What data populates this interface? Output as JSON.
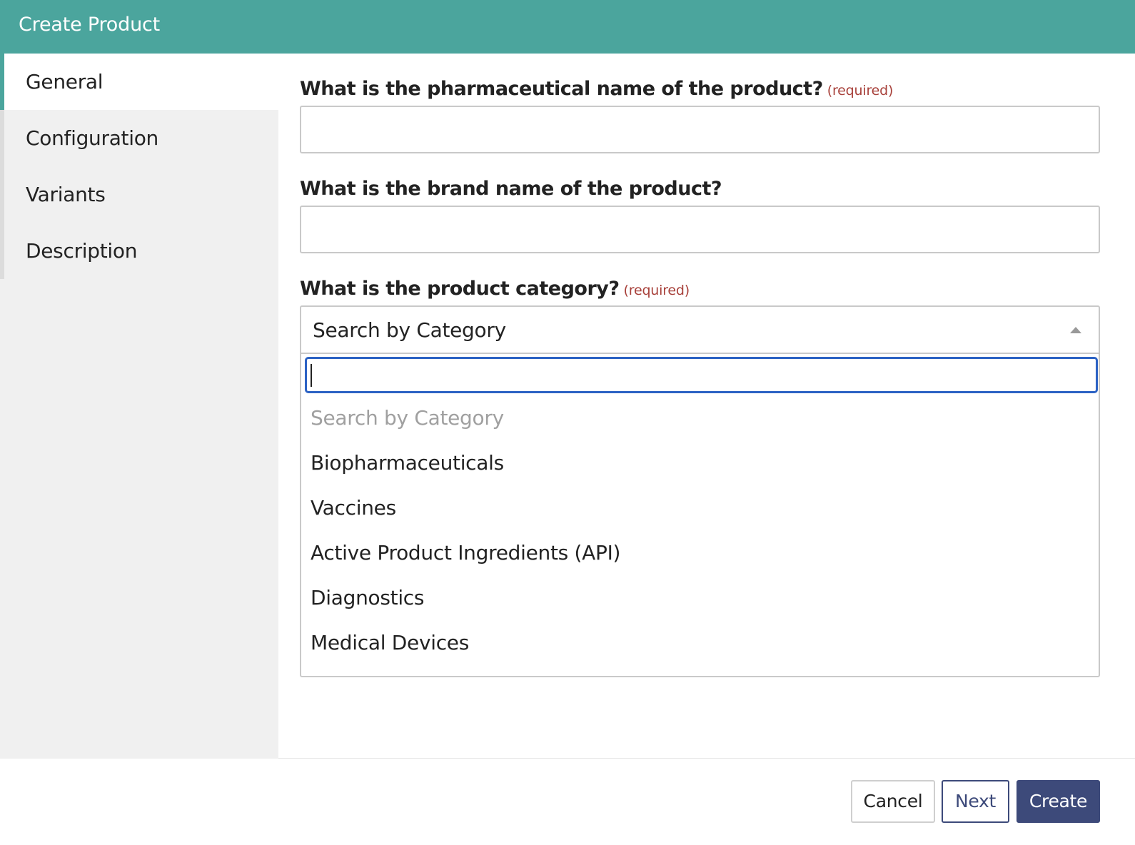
{
  "header": {
    "title": "Create Product"
  },
  "sidebar": {
    "items": [
      {
        "label": "General",
        "active": true
      },
      {
        "label": "Configuration",
        "active": false
      },
      {
        "label": "Variants",
        "active": false
      },
      {
        "label": "Description",
        "active": false
      }
    ]
  },
  "form": {
    "pharma_name": {
      "label": "What is the pharmaceutical name of the product?",
      "required": "(required)",
      "value": ""
    },
    "brand_name": {
      "label": "What is the brand name of the product?",
      "value": ""
    },
    "category": {
      "label": "What is the product category?",
      "required": "(required)",
      "selected": "Search by Category",
      "search_value": "",
      "options": [
        "Search by Category",
        "Biopharmaceuticals",
        "Vaccines",
        "Active Product Ingredients (API)",
        "Diagnostics",
        "Medical Devices"
      ]
    }
  },
  "footer": {
    "cancel": "Cancel",
    "next": "Next",
    "create": "Create"
  },
  "colors": {
    "accent": "#4ba59d",
    "primary": "#3d4a7a",
    "required": "#a8413b",
    "focus": "#2c62c4"
  }
}
